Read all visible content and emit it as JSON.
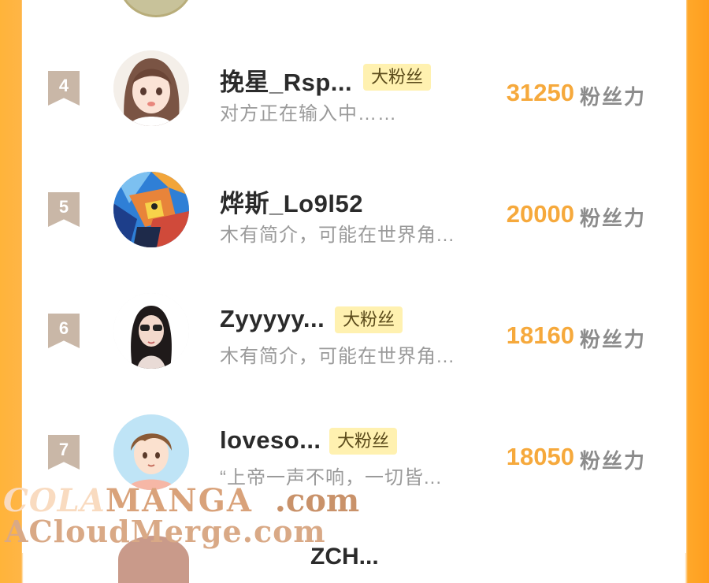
{
  "rows": [
    {
      "rank": "4",
      "name": "挽星_Rsp...",
      "badge": "大粉丝",
      "bio": "对方正在输入中……",
      "score": "31250",
      "unit": "粉丝力"
    },
    {
      "rank": "5",
      "name": "烨斯_Lo9l52",
      "badge": "",
      "bio": "木有简介，可能在世界角...",
      "score": "20000",
      "unit": "粉丝力"
    },
    {
      "rank": "6",
      "name": "Zyyyyy...",
      "badge": "大粉丝",
      "bio": "木有简介，可能在世界角...",
      "score": "18160",
      "unit": "粉丝力"
    },
    {
      "rank": "7",
      "name": "loveso...",
      "badge": "大粉丝",
      "bio": "“上帝一声不响，一切皆...",
      "score": "18050",
      "unit": "粉丝力"
    }
  ],
  "next_row_partial_name": "ZCH...",
  "watermark": {
    "line1_a": "COLA",
    "line1_b": "MANGA",
    "line1_c": ".com",
    "line2": "ACloudMerge.com"
  },
  "colors": {
    "accent_orange": "#f6a93c",
    "badge_bg": "#fff1b0",
    "rank_tag": "#c9b7a7",
    "frame_orange": "#ffa82a"
  }
}
